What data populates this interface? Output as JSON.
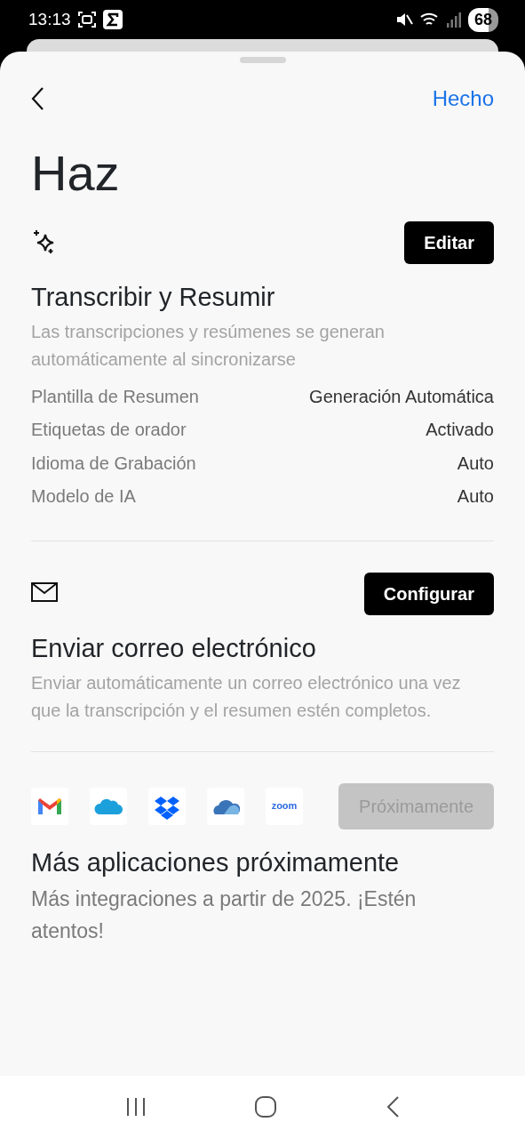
{
  "status_bar": {
    "time": "13:13",
    "battery": "68"
  },
  "header": {
    "done": "Hecho"
  },
  "title": "Haz",
  "sections": [
    {
      "kind": "summary",
      "button": "Editar",
      "title": "Transcribir y Resumir",
      "description": "Las transcripciones y resúmenes se generan automáticamente al sincronizarse",
      "settings": [
        {
          "label": "Plantilla de Resumen",
          "value": "Generación Automática"
        },
        {
          "label": "Etiquetas de orador",
          "value": "Activado"
        },
        {
          "label": "Idioma de Grabación",
          "value": "Auto"
        },
        {
          "label": "Modelo de IA",
          "value": "Auto"
        }
      ]
    },
    {
      "kind": "email",
      "button": "Configurar",
      "title": "Enviar correo electrónico",
      "description": "Enviar automáticamente un correo electrónico una vez que la transcripción y el resumen estén completos."
    },
    {
      "kind": "apps",
      "button": "Próximamente",
      "disabled": true,
      "apps": [
        {
          "kind": "mail"
        },
        {
          "kind": "cloud-blue"
        },
        {
          "kind": "boxes"
        },
        {
          "kind": "cloud-layers"
        },
        {
          "kind": "wordmark",
          "label": "zoom"
        }
      ],
      "title": "Más aplicaciones próximamente",
      "description": "Más integraciones a partir de 2025. ¡Estén atentos!"
    }
  ]
}
